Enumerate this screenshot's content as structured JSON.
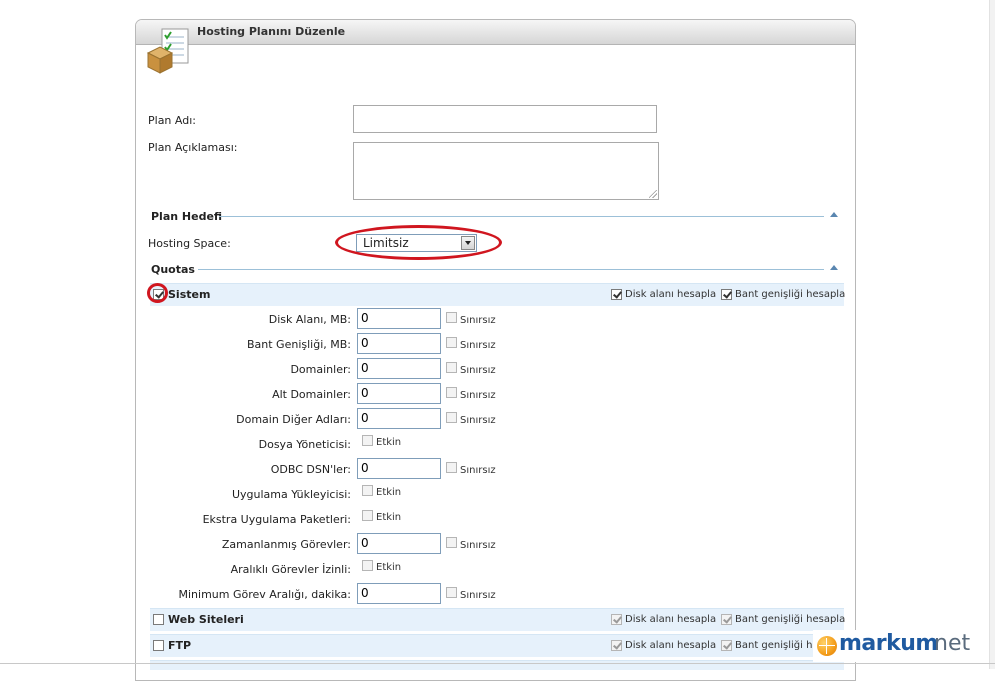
{
  "window": {
    "title": "Hosting Planını Düzenle"
  },
  "form": {
    "plan_name_label": "Plan Adı:",
    "plan_name_value": "",
    "plan_desc_label": "Plan Açıklaması:",
    "plan_desc_value": ""
  },
  "plan_target": {
    "section_title": "Plan Hedefi",
    "hosting_space_label": "Hosting Space:",
    "hosting_space_value": "Limitsiz"
  },
  "quotas": {
    "section_title": "Quotas",
    "disk_calc_label": "Disk alanı hesapla",
    "bandwidth_calc_label": "Bant genişliği hesapla",
    "unlimited_label": "Sınırsız",
    "enabled_label": "Etkin",
    "groups": [
      {
        "name": "Sistem",
        "checked": true,
        "disk_calc": true,
        "bandwidth_calc": true
      },
      {
        "name": "Web Siteleri",
        "checked": false,
        "disk_calc": true,
        "bandwidth_calc": true
      },
      {
        "name": "FTP",
        "checked": false,
        "disk_calc": true,
        "bandwidth_calc": true
      }
    ],
    "system_rows": [
      {
        "label": "Disk Alanı, MB:",
        "type": "number",
        "value": "0"
      },
      {
        "label": "Bant Genişliği, MB:",
        "type": "number",
        "value": "0"
      },
      {
        "label": "Domainler:",
        "type": "number",
        "value": "0"
      },
      {
        "label": "Alt Domainler:",
        "type": "number",
        "value": "0"
      },
      {
        "label": "Domain Diğer Adları:",
        "type": "number",
        "value": "0"
      },
      {
        "label": "Dosya Yöneticisi:",
        "type": "toggle"
      },
      {
        "label": "ODBC DSN'ler:",
        "type": "number",
        "value": "0"
      },
      {
        "label": "Uygulama Yükleyicisi:",
        "type": "toggle"
      },
      {
        "label": "Ekstra Uygulama Paketleri:",
        "type": "toggle"
      },
      {
        "label": "Zamanlanmış Görevler:",
        "type": "number",
        "value": "0"
      },
      {
        "label": "Aralıklı Görevler İzinli:",
        "type": "toggle"
      },
      {
        "label": "Minimum Görev Aralığı, dakika:",
        "type": "number",
        "value": "0"
      }
    ]
  },
  "logo": {
    "brand_main": "markum",
    "brand_suffix": "net"
  },
  "colors": {
    "highlight": "#d0161f",
    "group_bg": "#e6f1fb",
    "brand_blue": "#1f5aa0"
  }
}
